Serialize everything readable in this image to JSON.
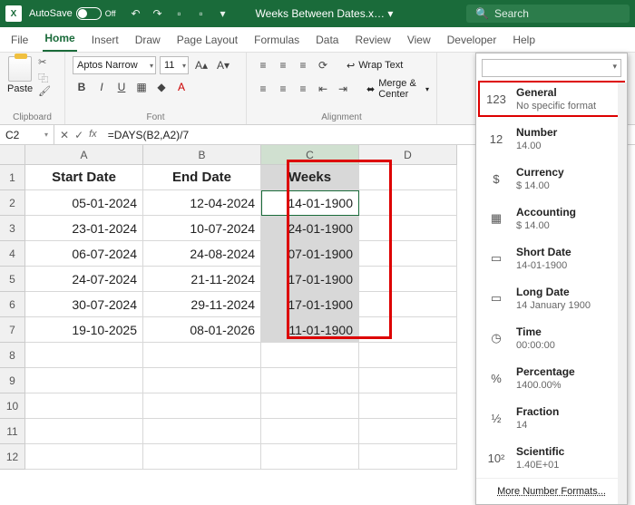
{
  "titlebar": {
    "autosave_label": "AutoSave",
    "autosave_state": "Off",
    "doc_title": "Weeks Between Dates.x… ▾",
    "search_placeholder": "Search"
  },
  "tabs": [
    "File",
    "Home",
    "Insert",
    "Draw",
    "Page Layout",
    "Formulas",
    "Data",
    "Review",
    "View",
    "Developer",
    "Help"
  ],
  "active_tab": "Home",
  "ribbon": {
    "paste_label": "Paste",
    "clipboard_label": "Clipboard",
    "font_name": "Aptos Narrow",
    "font_size": "11",
    "font_label": "Font",
    "wrap_label": "Wrap Text",
    "merge_label": "Merge & Center",
    "alignment_label": "Alignment"
  },
  "number_formats": [
    {
      "name": "General",
      "sample": "No specific format",
      "icon": "123",
      "highlight": true
    },
    {
      "name": "Number",
      "sample": "14.00",
      "icon": "12"
    },
    {
      "name": "Currency",
      "sample": "$ 14.00",
      "icon": "$"
    },
    {
      "name": "Accounting",
      "sample": "$ 14.00",
      "icon": "▦"
    },
    {
      "name": "Short Date",
      "sample": "14-01-1900",
      "icon": "▭"
    },
    {
      "name": "Long Date",
      "sample": "14 January 1900",
      "icon": "▭"
    },
    {
      "name": "Time",
      "sample": "00:00:00",
      "icon": "◷"
    },
    {
      "name": "Percentage",
      "sample": "1400.00%",
      "icon": "%"
    },
    {
      "name": "Fraction",
      "sample": "14",
      "icon": "½"
    },
    {
      "name": "Scientific",
      "sample": "1.40E+01",
      "icon": "10²"
    }
  ],
  "nf_more": "More Number Formats...",
  "formula_bar": {
    "cell_ref": "C2",
    "formula": "=DAYS(B2,A2)/7"
  },
  "columns": [
    "A",
    "B",
    "C",
    "D"
  ],
  "row_numbers": [
    "1",
    "2",
    "3",
    "4",
    "5",
    "6",
    "7",
    "8",
    "9",
    "10",
    "11",
    "12"
  ],
  "table": {
    "headers": {
      "A": "Start Date",
      "B": "End Date",
      "C": "Weeks"
    },
    "rows": [
      {
        "A": "05-01-2024",
        "B": "12-04-2024",
        "C": "14-01-1900"
      },
      {
        "A": "23-01-2024",
        "B": "10-07-2024",
        "C": "24-01-1900"
      },
      {
        "A": "06-07-2024",
        "B": "24-08-2024",
        "C": "07-01-1900"
      },
      {
        "A": "24-07-2024",
        "B": "21-11-2024",
        "C": "17-01-1900"
      },
      {
        "A": "30-07-2024",
        "B": "29-11-2024",
        "C": "17-01-1900"
      },
      {
        "A": "19-10-2025",
        "B": "08-01-2026",
        "C": "11-01-1900"
      }
    ]
  },
  "colors": {
    "accent": "#1a6b3a",
    "highlight_red": "#d00000"
  }
}
